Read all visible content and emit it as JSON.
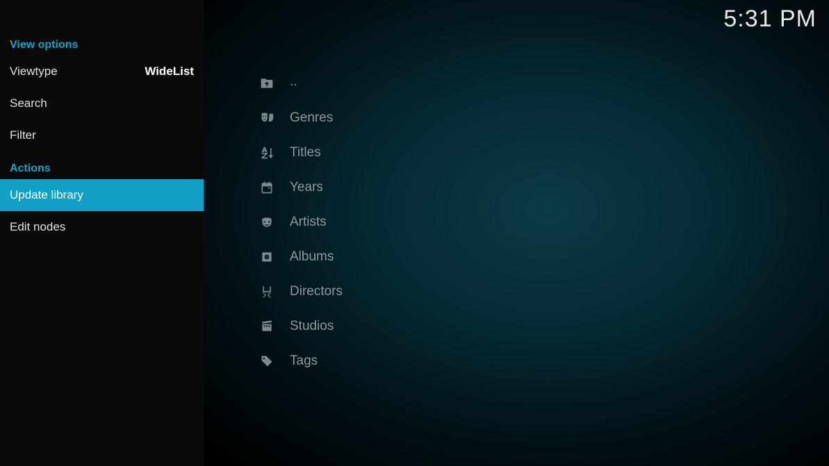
{
  "clock": "5:31 PM",
  "sidebar": {
    "section_view": "View options",
    "viewtype_label": "Viewtype",
    "viewtype_value": "WideList",
    "search_label": "Search",
    "filter_label": "Filter",
    "section_actions": "Actions",
    "update_library_label": "Update library",
    "edit_nodes_label": "Edit nodes"
  },
  "list": {
    "up": "..",
    "genres": "Genres",
    "titles": "Titles",
    "years": "Years",
    "artists": "Artists",
    "albums": "Albums",
    "directors": "Directors",
    "studios": "Studios",
    "tags": "Tags"
  }
}
